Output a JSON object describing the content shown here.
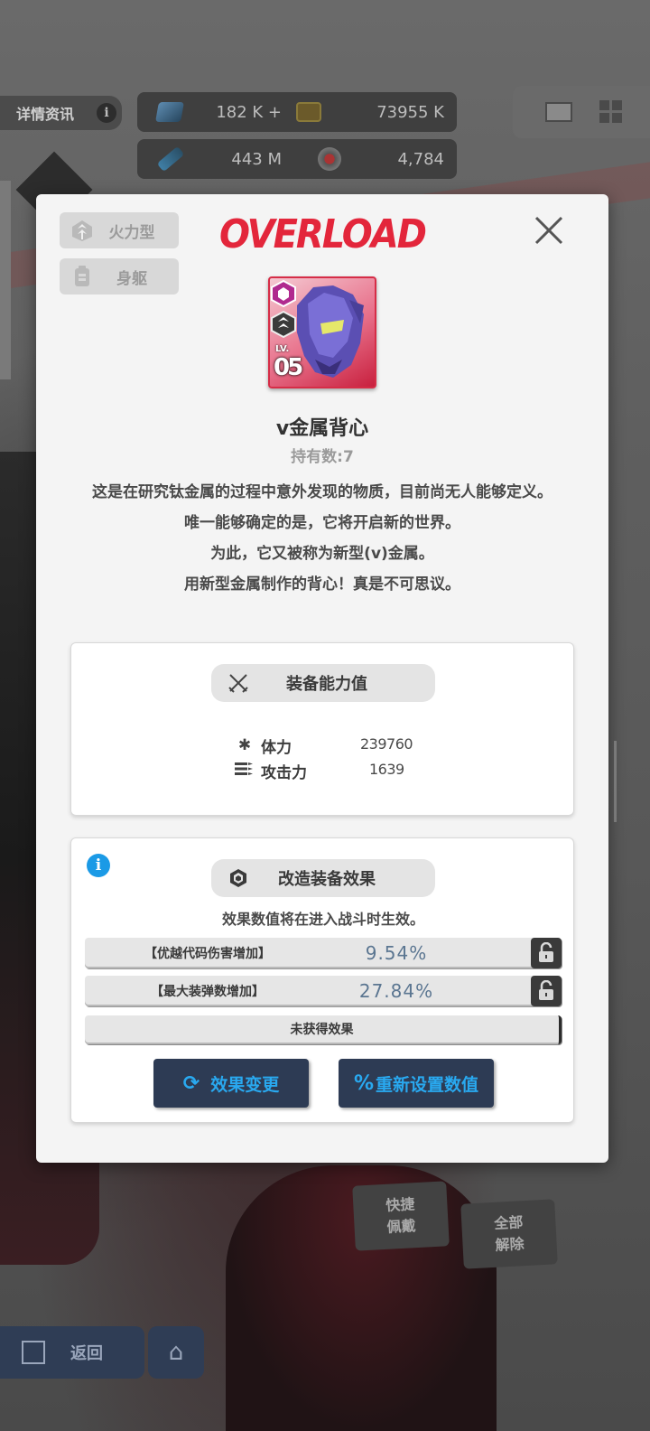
{
  "hud": {
    "detail_label": "详情资讯",
    "info_glyph": "i",
    "resources": [
      {
        "icon": "gem-icon",
        "value": "182 K +"
      },
      {
        "icon": "credit-card-icon",
        "value": "73955 K"
      },
      {
        "icon": "battery-icon",
        "value": "443 M"
      },
      {
        "icon": "core-orb-icon",
        "value": "4,784"
      }
    ]
  },
  "bottom": {
    "back_label": "返回",
    "quick_equip_line1": "快捷",
    "quick_equip_line2": "佩戴",
    "unequip_all_line1": "全部",
    "unequip_all_line2": "解除"
  },
  "modal": {
    "class_tag": "火力型",
    "slot_tag": "身躯",
    "brand": "OVERLOAD",
    "item": {
      "lv_label": "LV.",
      "level": "05",
      "name": "v金属背心",
      "count_text": "持有数:7",
      "description": [
        "这是在研究钛金属的过程中意外发现的物质，目前尚无人能够定义。",
        "唯一能够确定的是，它将开启新的世界。",
        "为此，它又被称为新型(v)金属。",
        "用新型金属制作的背心！真是不可思议。"
      ]
    },
    "stats_panel": {
      "title": "装备能力值",
      "rows": [
        {
          "label": "体力",
          "value": "239760",
          "icon": "asterisk-icon"
        },
        {
          "label": "攻击力",
          "value": "1639",
          "icon": "bullets-icon"
        }
      ]
    },
    "effects_panel": {
      "title": "改造装备效果",
      "note": "效果数值将在进入战斗时生效。",
      "effects": [
        {
          "name": "【优越代码伤害增加】",
          "value": "9.54%"
        },
        {
          "name": "【最大装弹数增加】",
          "value": "27.84%"
        }
      ],
      "empty_label": "未获得效果",
      "change_button": "效果变更",
      "reset_button": "重新设置数值",
      "reset_glyph": "%"
    }
  },
  "colors": {
    "brand_red": "#e3263b",
    "button_navy": "#2d3b54",
    "button_text": "#29a9f0",
    "percent_text": "#5b7691",
    "info_blue": "#1b9ae6"
  }
}
